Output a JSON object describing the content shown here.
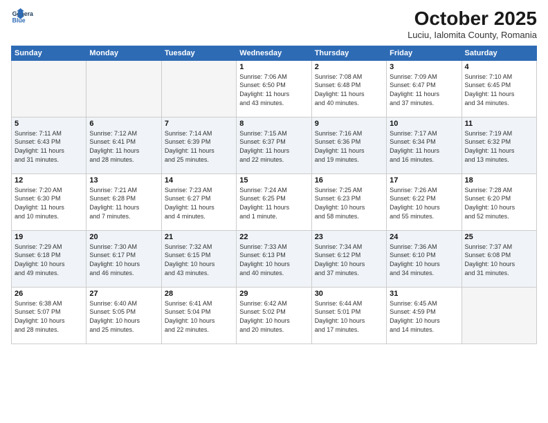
{
  "logo": {
    "line1": "General",
    "line2": "Blue"
  },
  "title": "October 2025",
  "subtitle": "Luciu, Ialomita County, Romania",
  "weekdays": [
    "Sunday",
    "Monday",
    "Tuesday",
    "Wednesday",
    "Thursday",
    "Friday",
    "Saturday"
  ],
  "weeks": [
    [
      {
        "day": "",
        "info": ""
      },
      {
        "day": "",
        "info": ""
      },
      {
        "day": "",
        "info": ""
      },
      {
        "day": "1",
        "info": "Sunrise: 7:06 AM\nSunset: 6:50 PM\nDaylight: 11 hours\nand 43 minutes."
      },
      {
        "day": "2",
        "info": "Sunrise: 7:08 AM\nSunset: 6:48 PM\nDaylight: 11 hours\nand 40 minutes."
      },
      {
        "day": "3",
        "info": "Sunrise: 7:09 AM\nSunset: 6:47 PM\nDaylight: 11 hours\nand 37 minutes."
      },
      {
        "day": "4",
        "info": "Sunrise: 7:10 AM\nSunset: 6:45 PM\nDaylight: 11 hours\nand 34 minutes."
      }
    ],
    [
      {
        "day": "5",
        "info": "Sunrise: 7:11 AM\nSunset: 6:43 PM\nDaylight: 11 hours\nand 31 minutes."
      },
      {
        "day": "6",
        "info": "Sunrise: 7:12 AM\nSunset: 6:41 PM\nDaylight: 11 hours\nand 28 minutes."
      },
      {
        "day": "7",
        "info": "Sunrise: 7:14 AM\nSunset: 6:39 PM\nDaylight: 11 hours\nand 25 minutes."
      },
      {
        "day": "8",
        "info": "Sunrise: 7:15 AM\nSunset: 6:37 PM\nDaylight: 11 hours\nand 22 minutes."
      },
      {
        "day": "9",
        "info": "Sunrise: 7:16 AM\nSunset: 6:36 PM\nDaylight: 11 hours\nand 19 minutes."
      },
      {
        "day": "10",
        "info": "Sunrise: 7:17 AM\nSunset: 6:34 PM\nDaylight: 11 hours\nand 16 minutes."
      },
      {
        "day": "11",
        "info": "Sunrise: 7:19 AM\nSunset: 6:32 PM\nDaylight: 11 hours\nand 13 minutes."
      }
    ],
    [
      {
        "day": "12",
        "info": "Sunrise: 7:20 AM\nSunset: 6:30 PM\nDaylight: 11 hours\nand 10 minutes."
      },
      {
        "day": "13",
        "info": "Sunrise: 7:21 AM\nSunset: 6:28 PM\nDaylight: 11 hours\nand 7 minutes."
      },
      {
        "day": "14",
        "info": "Sunrise: 7:23 AM\nSunset: 6:27 PM\nDaylight: 11 hours\nand 4 minutes."
      },
      {
        "day": "15",
        "info": "Sunrise: 7:24 AM\nSunset: 6:25 PM\nDaylight: 11 hours\nand 1 minute."
      },
      {
        "day": "16",
        "info": "Sunrise: 7:25 AM\nSunset: 6:23 PM\nDaylight: 10 hours\nand 58 minutes."
      },
      {
        "day": "17",
        "info": "Sunrise: 7:26 AM\nSunset: 6:22 PM\nDaylight: 10 hours\nand 55 minutes."
      },
      {
        "day": "18",
        "info": "Sunrise: 7:28 AM\nSunset: 6:20 PM\nDaylight: 10 hours\nand 52 minutes."
      }
    ],
    [
      {
        "day": "19",
        "info": "Sunrise: 7:29 AM\nSunset: 6:18 PM\nDaylight: 10 hours\nand 49 minutes."
      },
      {
        "day": "20",
        "info": "Sunrise: 7:30 AM\nSunset: 6:17 PM\nDaylight: 10 hours\nand 46 minutes."
      },
      {
        "day": "21",
        "info": "Sunrise: 7:32 AM\nSunset: 6:15 PM\nDaylight: 10 hours\nand 43 minutes."
      },
      {
        "day": "22",
        "info": "Sunrise: 7:33 AM\nSunset: 6:13 PM\nDaylight: 10 hours\nand 40 minutes."
      },
      {
        "day": "23",
        "info": "Sunrise: 7:34 AM\nSunset: 6:12 PM\nDaylight: 10 hours\nand 37 minutes."
      },
      {
        "day": "24",
        "info": "Sunrise: 7:36 AM\nSunset: 6:10 PM\nDaylight: 10 hours\nand 34 minutes."
      },
      {
        "day": "25",
        "info": "Sunrise: 7:37 AM\nSunset: 6:08 PM\nDaylight: 10 hours\nand 31 minutes."
      }
    ],
    [
      {
        "day": "26",
        "info": "Sunrise: 6:38 AM\nSunset: 5:07 PM\nDaylight: 10 hours\nand 28 minutes."
      },
      {
        "day": "27",
        "info": "Sunrise: 6:40 AM\nSunset: 5:05 PM\nDaylight: 10 hours\nand 25 minutes."
      },
      {
        "day": "28",
        "info": "Sunrise: 6:41 AM\nSunset: 5:04 PM\nDaylight: 10 hours\nand 22 minutes."
      },
      {
        "day": "29",
        "info": "Sunrise: 6:42 AM\nSunset: 5:02 PM\nDaylight: 10 hours\nand 20 minutes."
      },
      {
        "day": "30",
        "info": "Sunrise: 6:44 AM\nSunset: 5:01 PM\nDaylight: 10 hours\nand 17 minutes."
      },
      {
        "day": "31",
        "info": "Sunrise: 6:45 AM\nSunset: 4:59 PM\nDaylight: 10 hours\nand 14 minutes."
      },
      {
        "day": "",
        "info": ""
      }
    ]
  ]
}
